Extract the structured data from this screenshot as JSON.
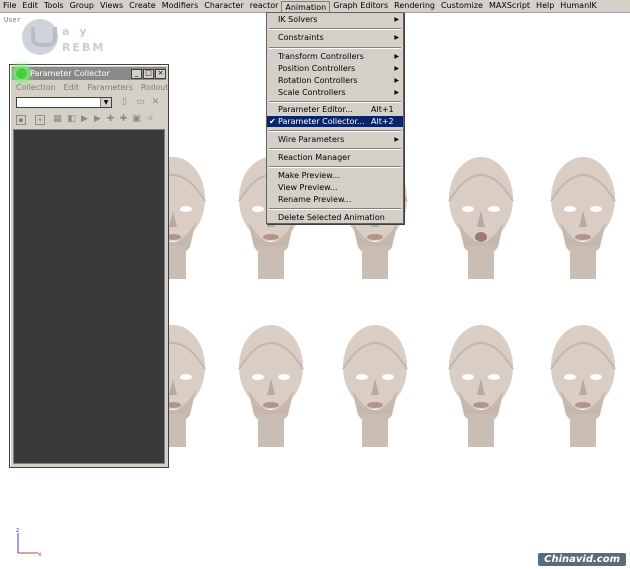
{
  "menubar": {
    "items": [
      "File",
      "Edit",
      "Tools",
      "Group",
      "Views",
      "Create",
      "Modifiers",
      "Character",
      "reactor",
      "Animation",
      "Graph Editors",
      "Rendering",
      "Customize",
      "MAXScript",
      "Help",
      "HumanIK"
    ]
  },
  "viewport": {
    "label": "User"
  },
  "logo": {
    "line1": "a y",
    "line2": "REBM"
  },
  "parameter_collector": {
    "title": "Parameter Collector",
    "menu": [
      "Collection",
      "Edit",
      "Parameters",
      "Rollout"
    ],
    "title_buttons": [
      "_",
      "□",
      "×"
    ]
  },
  "animation_menu": {
    "items": [
      {
        "label": "IK Solvers",
        "shortcut": "",
        "submenu": true,
        "checked": false
      },
      {
        "label": "Constraints",
        "shortcut": "",
        "submenu": true,
        "checked": false
      },
      {
        "label": "Transform Controllers",
        "shortcut": "",
        "submenu": true,
        "checked": false
      },
      {
        "label": "Position Controllers",
        "shortcut": "",
        "submenu": true,
        "checked": false
      },
      {
        "label": "Rotation Controllers",
        "shortcut": "",
        "submenu": true,
        "checked": false
      },
      {
        "label": "Scale Controllers",
        "shortcut": "",
        "submenu": true,
        "checked": false
      },
      {
        "label": "Parameter Editor...",
        "shortcut": "Alt+1",
        "submenu": false,
        "checked": false
      },
      {
        "label": "Parameter Collector...",
        "shortcut": "Alt+2",
        "submenu": false,
        "checked": true
      },
      {
        "label": "Wire Parameters",
        "shortcut": "",
        "submenu": true,
        "checked": false
      },
      {
        "label": "Reaction Manager",
        "shortcut": "",
        "submenu": false,
        "checked": false
      },
      {
        "label": "Make Preview...",
        "shortcut": "",
        "submenu": false,
        "checked": false
      },
      {
        "label": "View Preview...",
        "shortcut": "",
        "submenu": false,
        "checked": false
      },
      {
        "label": "Rename Preview...",
        "shortcut": "",
        "submenu": false,
        "checked": false
      },
      {
        "label": "Delete Selected Animation",
        "shortcut": "",
        "submenu": false,
        "checked": false
      }
    ],
    "highlighted_index": 7
  },
  "watermark": "Chinavid.com",
  "colors": {
    "menu_highlight": "#0a246a",
    "panel_dark": "#3a3a3a",
    "chrome": "#d4d0c8",
    "head_skin": "#d9cdc4"
  }
}
